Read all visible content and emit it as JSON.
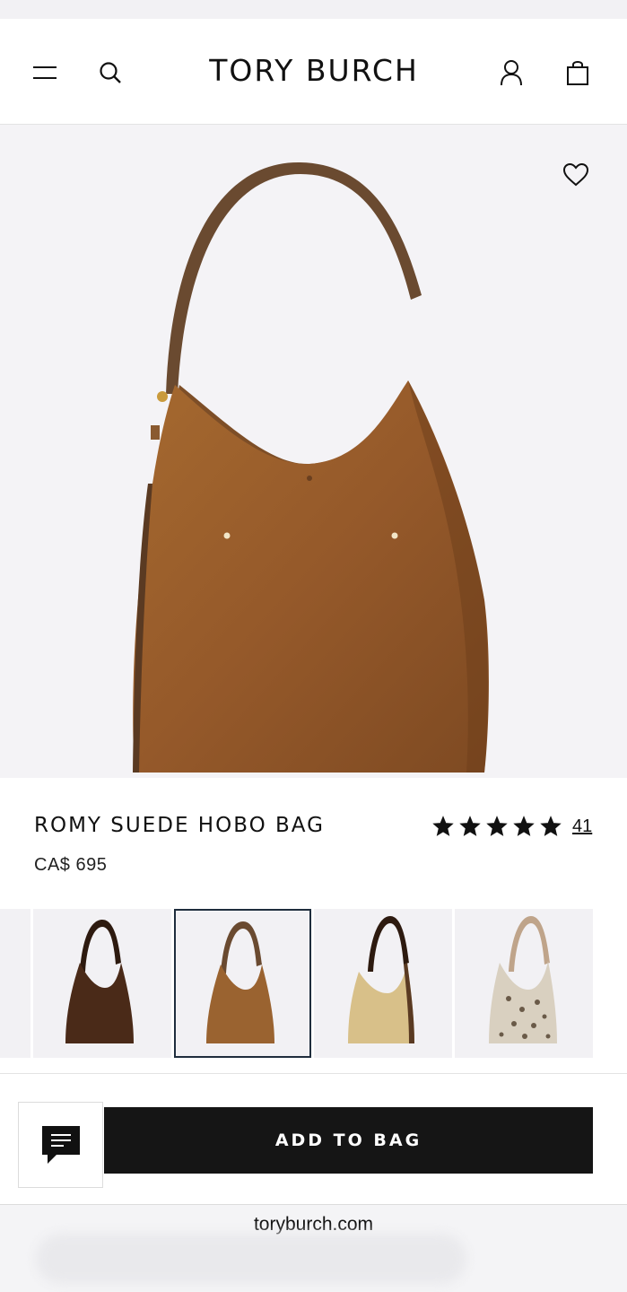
{
  "header": {
    "brand": "TORY BURCH",
    "icons": [
      "menu-icon",
      "search-icon",
      "account-icon",
      "shopping-bag-icon"
    ]
  },
  "product": {
    "title": "ROMY SUEDE HOBO BAG",
    "price": "CA$ 695",
    "rating_value": 5,
    "rating_max": 5,
    "review_count": "41"
  },
  "swatches": [
    {
      "name": "dark-brown",
      "color": "#4a2a18"
    },
    {
      "name": "caramel-suede",
      "color": "#9a6330",
      "selected": true
    },
    {
      "name": "natural-raffia",
      "color": "#d8c089"
    },
    {
      "name": "leopard-print",
      "color": "#cfc4b0"
    }
  ],
  "actions": {
    "add_to_bag": "ADD TO BAG"
  },
  "browser": {
    "url": "toryburch.com"
  },
  "colors": {
    "button_bg": "#151515",
    "selected_border": "#1f2d3d",
    "hero_bg": "#f4f3f6"
  }
}
